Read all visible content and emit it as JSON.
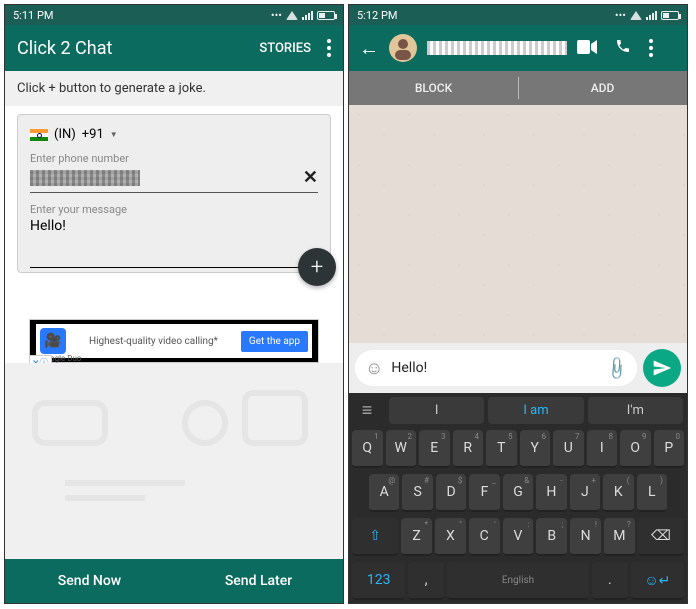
{
  "left": {
    "status_time": "5:11 PM",
    "app_title": "Click 2 Chat",
    "stories": "STORIES",
    "hint": "Click + button to generate a joke.",
    "country_code": "(IN)",
    "dial_code": "+91",
    "phone_placeholder": "Enter phone number",
    "msg_label": "Enter your message",
    "msg_value": "Hello!",
    "ad_brand": "Google Duo",
    "ad_text": "Highest-quality video calling*",
    "ad_cta": "Get the app",
    "send_now": "Send Now",
    "send_later": "Send Later"
  },
  "right": {
    "status_time": "5:12 PM",
    "block": "BLOCK",
    "add": "ADD",
    "compose_value": "Hello!",
    "suggestions": [
      "I",
      "I am",
      "I'm"
    ],
    "rows": {
      "r1": [
        {
          "m": "Q",
          "s": "1"
        },
        {
          "m": "W",
          "s": "2"
        },
        {
          "m": "E",
          "s": "3"
        },
        {
          "m": "R",
          "s": "4"
        },
        {
          "m": "T",
          "s": "5"
        },
        {
          "m": "Y",
          "s": "6"
        },
        {
          "m": "U",
          "s": "7"
        },
        {
          "m": "I",
          "s": "8"
        },
        {
          "m": "O",
          "s": "9"
        },
        {
          "m": "P",
          "s": "0"
        }
      ],
      "r2": [
        {
          "m": "A",
          "s": "@"
        },
        {
          "m": "S",
          "s": "#"
        },
        {
          "m": "D",
          "s": "$"
        },
        {
          "m": "F",
          "s": "_"
        },
        {
          "m": "G",
          "s": "&"
        },
        {
          "m": "H",
          "s": "-"
        },
        {
          "m": "J",
          "s": "+"
        },
        {
          "m": "K",
          "s": "("
        },
        {
          "m": "L",
          "s": ")"
        }
      ],
      "r3": [
        {
          "m": "Z",
          "s": "*"
        },
        {
          "m": "X",
          "s": "\""
        },
        {
          "m": "C",
          "s": "'"
        },
        {
          "m": "V",
          "s": ":"
        },
        {
          "m": "B",
          "s": ";"
        },
        {
          "m": "N",
          "s": "!"
        },
        {
          "m": "M",
          "s": "?"
        }
      ]
    },
    "numkey": "123",
    "comma": ",",
    "period": ".",
    "space": "English"
  }
}
